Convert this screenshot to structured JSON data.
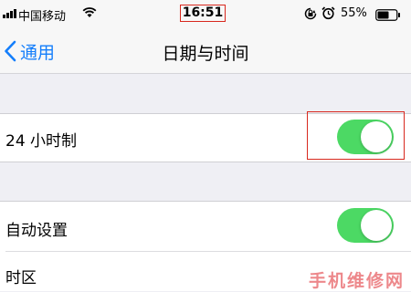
{
  "status_bar": {
    "carrier": "中国移动",
    "time": "16:51",
    "battery": "55%",
    "icons": [
      "signal-icon",
      "wifi-icon",
      "rotation-lock-icon",
      "alarm-icon",
      "battery-icon"
    ]
  },
  "nav": {
    "back_label": "通用",
    "title": "日期与时间"
  },
  "settings": {
    "24h": {
      "label": "24 小时制",
      "on": true
    },
    "auto_set": {
      "label": "自动设置",
      "on": true
    },
    "time_zone": {
      "label": "时区"
    }
  },
  "watermark": "手机维修网",
  "colors": {
    "accent": "#147efb",
    "toggle_on": "#4cd964",
    "highlight": "#d8281e",
    "background": "#efeff4"
  }
}
